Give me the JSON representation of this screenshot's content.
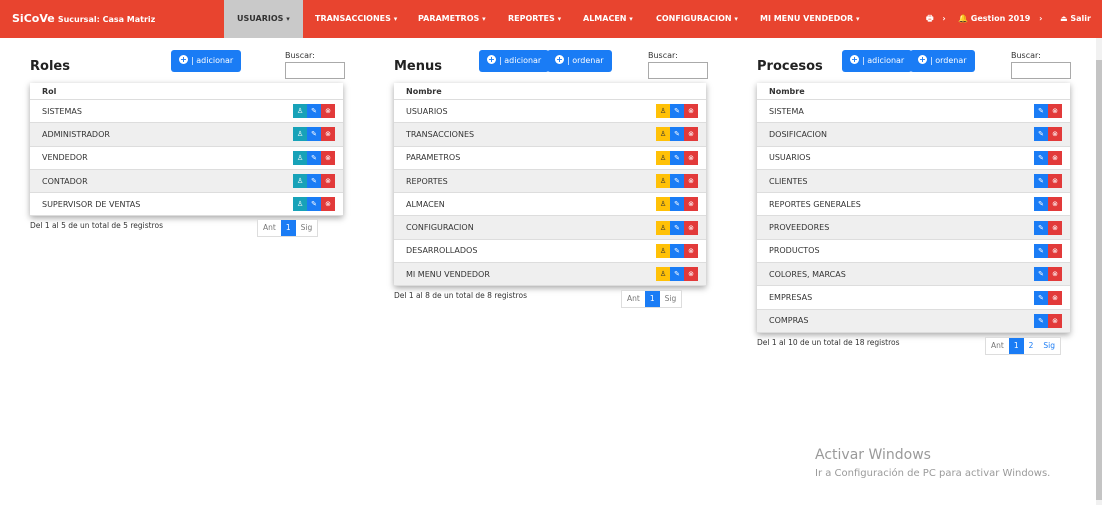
{
  "navbar": {
    "brand": "SiCoVe",
    "branch": "Sucursal: Casa Matriz",
    "menus": [
      {
        "label": "USUARIOS",
        "caret": "▾"
      },
      {
        "label": "TRANSACCIONES",
        "caret": "▾"
      },
      {
        "label": "PARAMETROS",
        "caret": "▾"
      },
      {
        "label": "REPORTES",
        "caret": "▾"
      },
      {
        "label": "ALMACEN",
        "caret": "▾"
      },
      {
        "label": "CONFIGURACION",
        "caret": "▾"
      },
      {
        "label": "MI MENU VENDEDOR",
        "caret": "▾"
      }
    ],
    "gestion": "Gestion 2019",
    "salir": "Salir",
    "arrow": "›",
    "colors": {
      "bar": "#e8442f",
      "active": "#c9c9c9"
    }
  },
  "roles": {
    "title": "Roles",
    "add_label": "| adicionar",
    "search_label": "Buscar:",
    "column": "Rol",
    "rows": [
      "SISTEMAS",
      "ADMINISTRADOR",
      "VENDEDOR",
      "CONTADOR",
      "SUPERVISOR DE VENTAS"
    ],
    "info": "Del 1 al 5 de un total de 5 registros",
    "pager": {
      "prev": "Ant",
      "current": "1",
      "next": "Sig"
    }
  },
  "menus": {
    "title": "Menus",
    "add_label": "| adicionar",
    "order_label": "| ordenar",
    "search_label": "Buscar:",
    "column": "Nombre",
    "rows": [
      "USUARIOS",
      "TRANSACCIONES",
      "PARAMETROS",
      "REPORTES",
      "ALMACEN",
      "CONFIGURACION",
      "DESARROLLADOS",
      "MI MENU VENDEDOR"
    ],
    "info": "Del 1 al 8 de un total de 8 registros",
    "pager": {
      "prev": "Ant",
      "current": "1",
      "next": "Sig"
    }
  },
  "procesos": {
    "title": "Procesos",
    "add_label": "| adicionar",
    "order_label": "| ordenar",
    "search_label": "Buscar:",
    "column": "Nombre",
    "rows": [
      "SISTEMA",
      "DOSIFICACION",
      "USUARIOS",
      "CLIENTES",
      "REPORTES GENERALES",
      "PROVEEDORES",
      "PRODUCTOS",
      "COLORES, MARCAS",
      "EMPRESAS",
      "COMPRAS"
    ],
    "info": "Del 1 al 10 de un total de 18 registros",
    "pager": {
      "prev": "Ant",
      "current": "1",
      "page2": "2",
      "next": "Sig"
    }
  },
  "icons": {
    "plus": "+",
    "edit": "✎",
    "delete": "⊗",
    "assign": "♙",
    "bell": "🔔",
    "printer": "🖶",
    "logout": "⏏"
  },
  "watermark": {
    "title": "Activar Windows",
    "subtitle": "Ir a Configuración de PC para activar Windows."
  }
}
